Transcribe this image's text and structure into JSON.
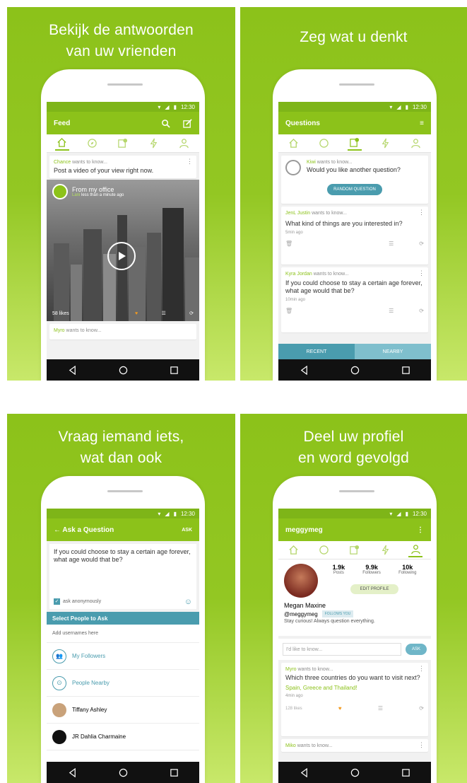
{
  "panels": {
    "p1": {
      "headline": [
        "Bekijk de antwoorden",
        "van uw vrienden"
      ]
    },
    "p2": {
      "headline": [
        "Zeg wat u denkt"
      ]
    },
    "p3": {
      "headline": [
        "Vraag iemand iets,",
        "wat dan ook"
      ]
    },
    "p4": {
      "headline": [
        "Deel uw profiel",
        "en word gevolgd"
      ]
    }
  },
  "status_time": "12:30",
  "feed": {
    "title": "Feed",
    "post1": {
      "user": "Chance",
      "wants": "wants to know...",
      "text": "Post a video of your view right now."
    },
    "video": {
      "location": "From my office",
      "user": "Lani",
      "time": "less than a minute ago",
      "likes": "58 likes"
    },
    "post2": {
      "user": "Myro",
      "wants": "wants to know..."
    }
  },
  "questions": {
    "title": "Questions",
    "random": {
      "user": "Kiwi",
      "wants": "wants to know...",
      "text": "Would you like another question?",
      "button": "RANDOM QUESTION"
    },
    "q1": {
      "user": "JenL Justin",
      "wants": "wants to know...",
      "text": "What kind of things are you interested in?",
      "time": "5min ago"
    },
    "q2": {
      "user": "Kyra Jordan",
      "wants": "wants to know...",
      "text": "If you could choose to stay a certain age forever, what age would that be?",
      "time": "10min ago"
    },
    "tabs": {
      "recent": "RECENT",
      "nearby": "NEARBY"
    }
  },
  "ask": {
    "title": "Ask a Question",
    "action": "ASK",
    "text": "If you could choose to stay a certain age forever, what age would that be?",
    "anon": "ask anonymously",
    "section": "Select People to Ask",
    "placeholder": "Add usernames here",
    "people": [
      "My Followers",
      "People Nearby",
      "Tiffany Ashley",
      "JR Dahlia Charmaine"
    ]
  },
  "profile": {
    "username": "meggymeg",
    "stats": [
      {
        "n": "1.9k",
        "l": "Posts"
      },
      {
        "n": "9.9k",
        "l": "Followers"
      },
      {
        "n": "10k",
        "l": "Following"
      }
    ],
    "edit": "EDIT PROFILE",
    "name": "Megan Maxine",
    "handle": "@meggymeg",
    "follows": "FOLLOWS YOU",
    "bio": "Stay curious! Always question everything.",
    "ask_placeholder": "I'd like to know...",
    "ask_btn": "ASK",
    "card1": {
      "user": "Myro",
      "wants": "wants to know...",
      "text": "Which three countries do you want to visit next?",
      "answer": "Spain, Greece and Thailand!",
      "time": "4min ago",
      "likes": "128 likes"
    },
    "card2": {
      "user": "Miko",
      "wants": "wants to know..."
    }
  },
  "colors": {
    "accent": "#8cc21a",
    "teal": "#4a9cae"
  }
}
